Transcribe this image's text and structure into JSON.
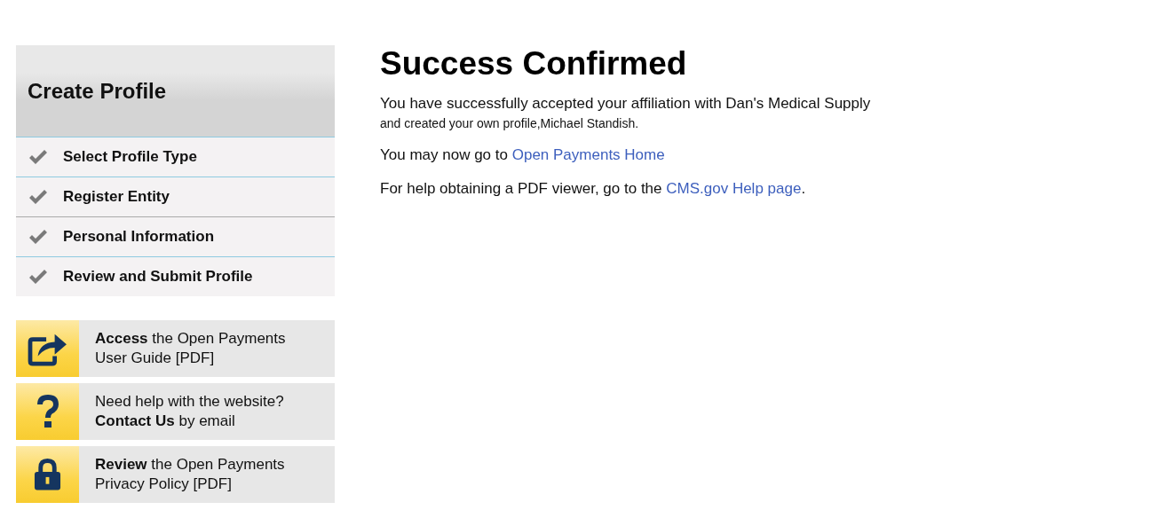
{
  "sidebar": {
    "title": "Create Profile",
    "steps": [
      {
        "label": "Select Profile Type",
        "completed": true
      },
      {
        "label": "Register Entity",
        "completed": true
      },
      {
        "label": "Personal Information",
        "completed": true
      },
      {
        "label": "Review and Submit Profile",
        "completed": true
      }
    ]
  },
  "help_cards": [
    {
      "kind": "share",
      "text": "**Access** the Open Payments User Guide [PDF]"
    },
    {
      "kind": "question",
      "text": "Need help with the website? **Contact Us** by email"
    },
    {
      "kind": "lock",
      "text": "**Review** the Open Payments Privacy Policy [PDF]"
    }
  ],
  "main": {
    "title": "Success Confirmed",
    "message": "You have successfully accepted your affiliation with Dan's Medical Supply",
    "message_detail": "and created your own profile,Michael Standish.",
    "links": [
      {
        "before": "You may now go to ",
        "link": "Open Payments Home"
      },
      {
        "before": "For help obtaining a PDF viewer, go to the ",
        "link": "CMS.gov Help page",
        "after": "."
      }
    ]
  }
}
